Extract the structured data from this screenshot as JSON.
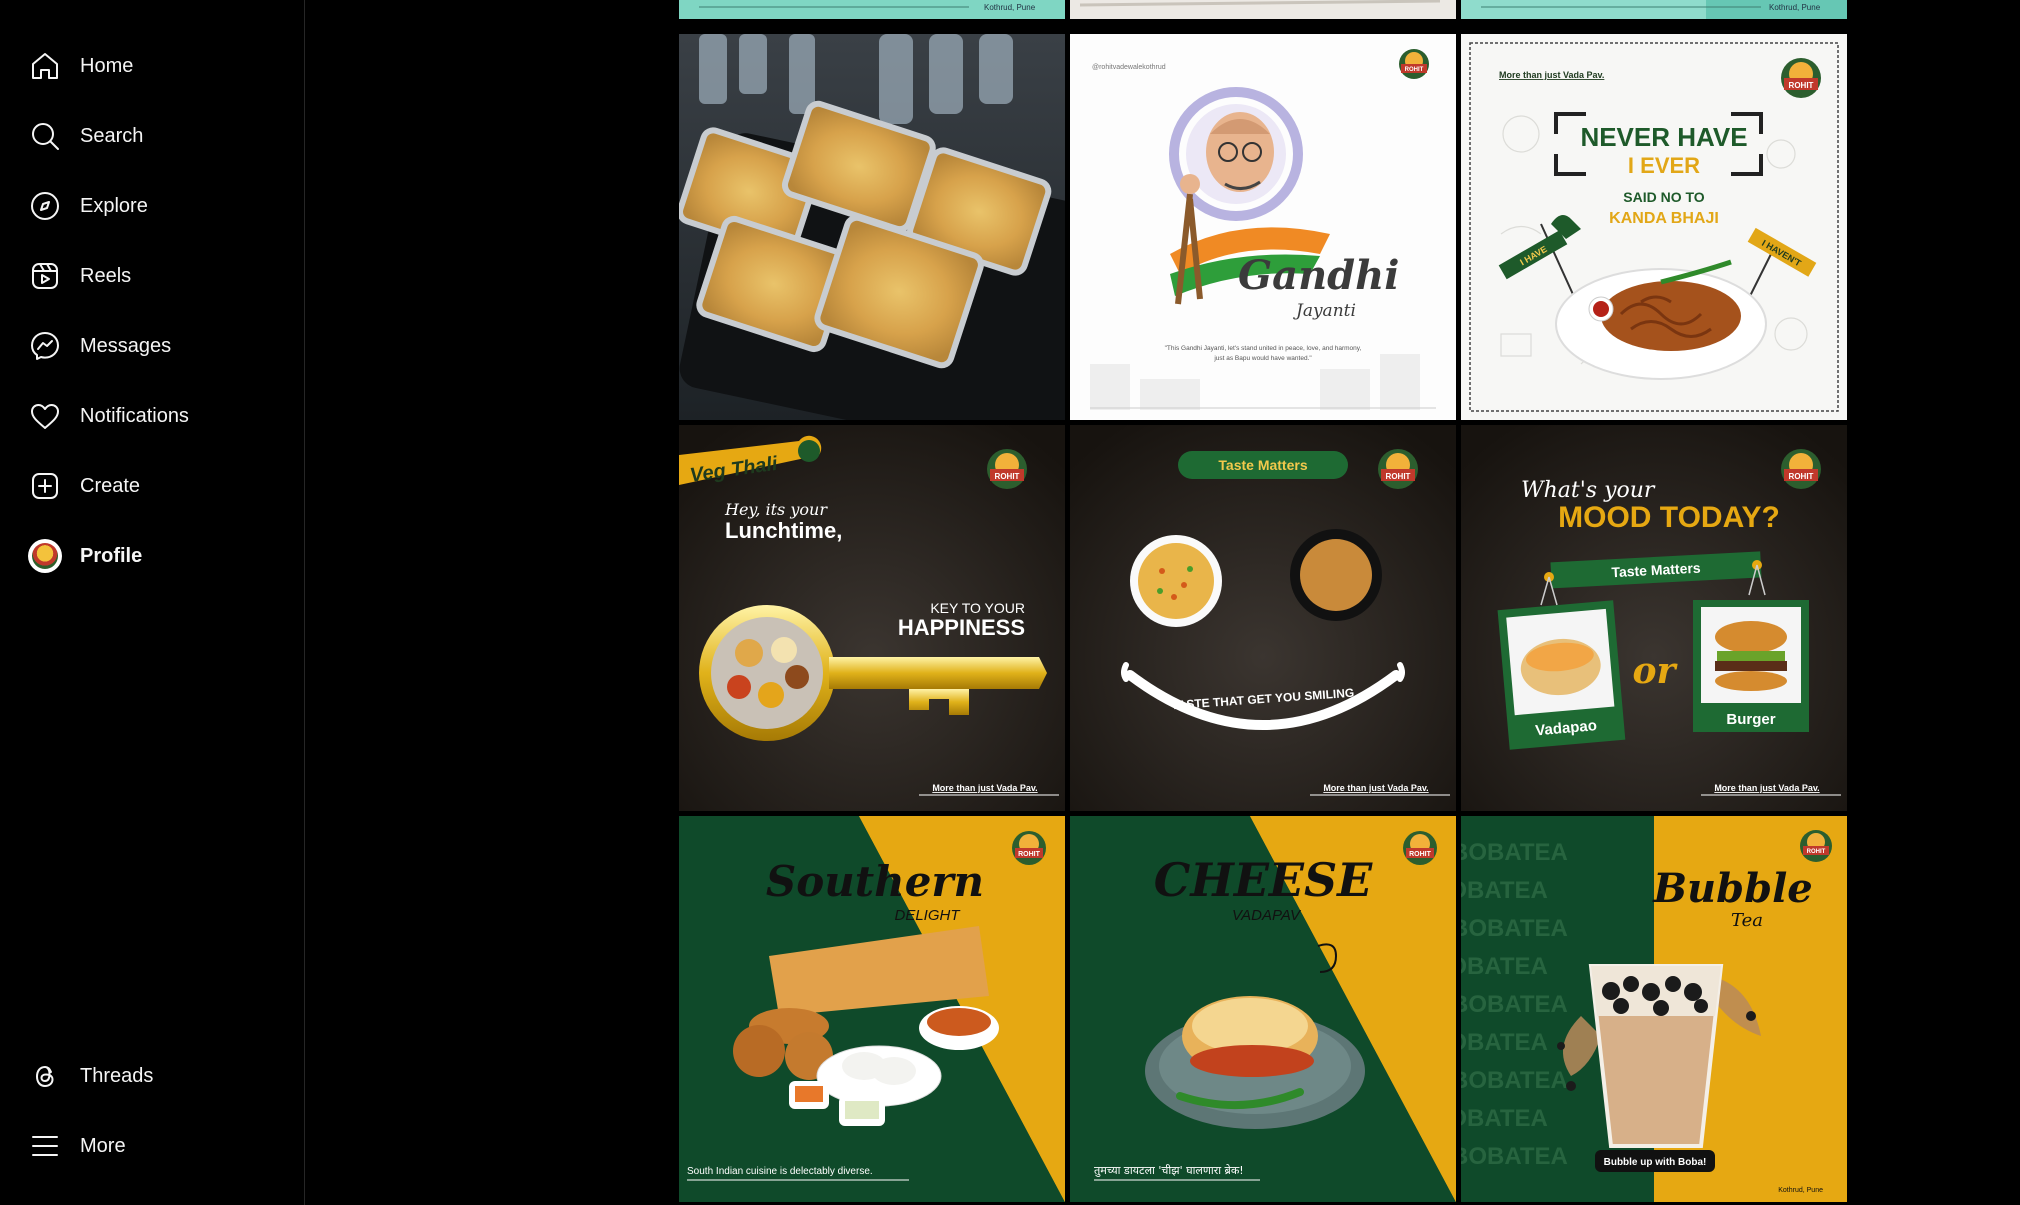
{
  "sidebar": {
    "items": [
      {
        "label": "Home",
        "icon": "home-icon"
      },
      {
        "label": "Search",
        "icon": "search-icon"
      },
      {
        "label": "Explore",
        "icon": "compass-icon"
      },
      {
        "label": "Reels",
        "icon": "reels-icon"
      },
      {
        "label": "Messages",
        "icon": "messenger-icon"
      },
      {
        "label": "Notifications",
        "icon": "heart-icon"
      },
      {
        "label": "Create",
        "icon": "plus-square-icon"
      },
      {
        "label": "Profile",
        "icon": "avatar"
      }
    ],
    "bottom": [
      {
        "label": "Threads",
        "icon": "threads-icon"
      },
      {
        "label": "More",
        "icon": "menu-icon"
      }
    ]
  },
  "posts": {
    "row0": {
      "t1_location": "Kothrud, Pune",
      "t3_location": "Kothrud, Pune"
    },
    "gandhi": {
      "handle": "@rohitvadewalekothrud",
      "title": "Gandhi",
      "subtitle": "Jayanti",
      "quote_line1": "\"This Gandhi Jayanti, let's stand united in peace, love, and harmony,",
      "quote_line2": "just as Bapu would have wanted.\""
    },
    "kanda": {
      "tag": "More than just Vada Pav.",
      "line1": "NEVER HAVE",
      "line2": "I EVER",
      "line3": "SAID NO TO",
      "line4": "KANDA BHAJI",
      "sign_left": "I HAVE",
      "sign_right": "I HAVEN'T"
    },
    "thali": {
      "badge": "Veg Thali",
      "hey": "Hey, its your",
      "lunch": "Lunchtime,",
      "key": "KEY TO YOUR",
      "happiness": "HAPPINESS",
      "tag": "More than just Vada Pav."
    },
    "taste": {
      "pill": "Taste Matters",
      "smile": "TASTE THAT GET YOU SMILING",
      "tag": "More than just Vada Pav."
    },
    "mood": {
      "whats": "What's your",
      "mood": "MOOD TODAY?",
      "banner": "Taste Matters",
      "left": "Vadapao",
      "or": "or",
      "right": "Burger",
      "tag": "More than just Vada Pav."
    },
    "southern": {
      "title": "Southern",
      "sub": "DELIGHT",
      "caption": "South Indian cuisine is delectably diverse."
    },
    "cheese": {
      "title": "CHEESE",
      "sub": "VADAPAV",
      "caption": "तुमच्या डायटला 'चीझ' घालणारा ब्रेक!"
    },
    "boba": {
      "title": "Bubble",
      "sub": "Tea",
      "bg_word": "BOBATEA",
      "pill": "Bubble up with Boba!",
      "location": "Kothrud, Pune"
    },
    "logo_text": "ROHIT"
  },
  "colors": {
    "green": "#0f4a2a",
    "yellow": "#e6a812",
    "mint": "#7fd6c3"
  }
}
